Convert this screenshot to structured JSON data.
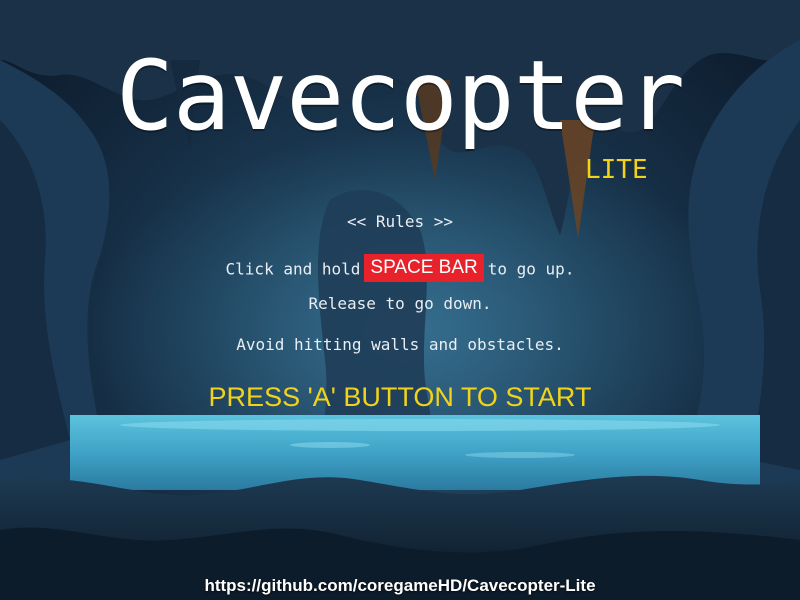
{
  "game": {
    "title": "Cavecopter",
    "subtitle": "LITE"
  },
  "rules": {
    "heading": "<< Rules >>",
    "line1_before": "Click and hold",
    "key_label": "SPACE BAR",
    "line1_after": "to go up.",
    "line2": "Release to go down.",
    "line3": "Avoid hitting walls and obstacles."
  },
  "start_prompt": "PRESS 'A' BUTTON TO START",
  "footer": {
    "url": "https://github.com/coregameHD/Cavecopter-Lite"
  },
  "colors": {
    "accent_yellow": "#f2d31a",
    "key_badge_red": "#e8222b",
    "water": "#3fa3c7",
    "cave_dark": "#13283d"
  }
}
